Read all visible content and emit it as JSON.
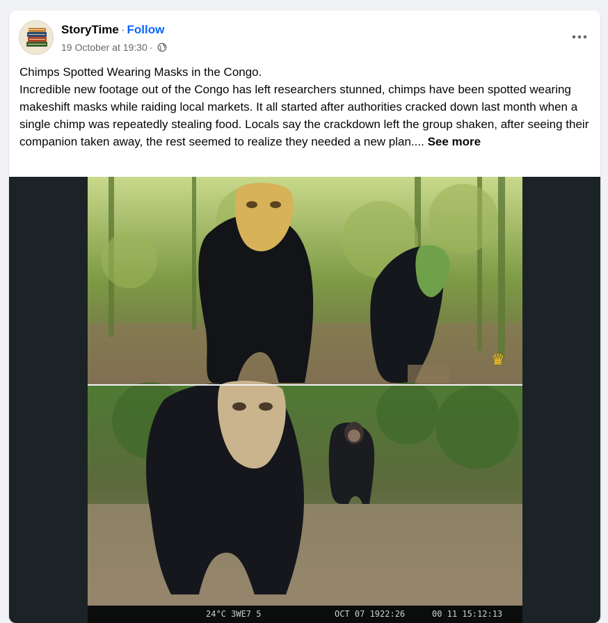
{
  "post": {
    "author": "StoryTime",
    "separator": "·",
    "follow_label": "Follow",
    "timestamp": "19 October at 19:30",
    "meta_separator": "·",
    "privacy_icon": "globe-icon",
    "more_icon": "more-options-icon",
    "text_title": "Chimps Spotted Wearing Masks in the Congo.",
    "text_body": "Incredible new footage out of the Congo has left researchers stunned, chimps have been spotted wearing makeshift masks while raiding local markets. It all started after authorities cracked down last month when a single chimp was repeatedly stealing food. Locals say the crackdown left the group shaken, after seeing their companion taken away, the rest seemed to realize they needed a new plan....",
    "see_more_label": "See more"
  },
  "media": {
    "overlay_icon": "crown-icon",
    "camera_strip": {
      "temp": "24°C 3WE7 5",
      "date": "OCT 07 1922:26",
      "time": "00 11 15:12:13"
    }
  },
  "colors": {
    "link": "#0866ff",
    "secondary_text": "#65676b",
    "media_background": "#1c2326",
    "card_background": "#ffffff"
  }
}
